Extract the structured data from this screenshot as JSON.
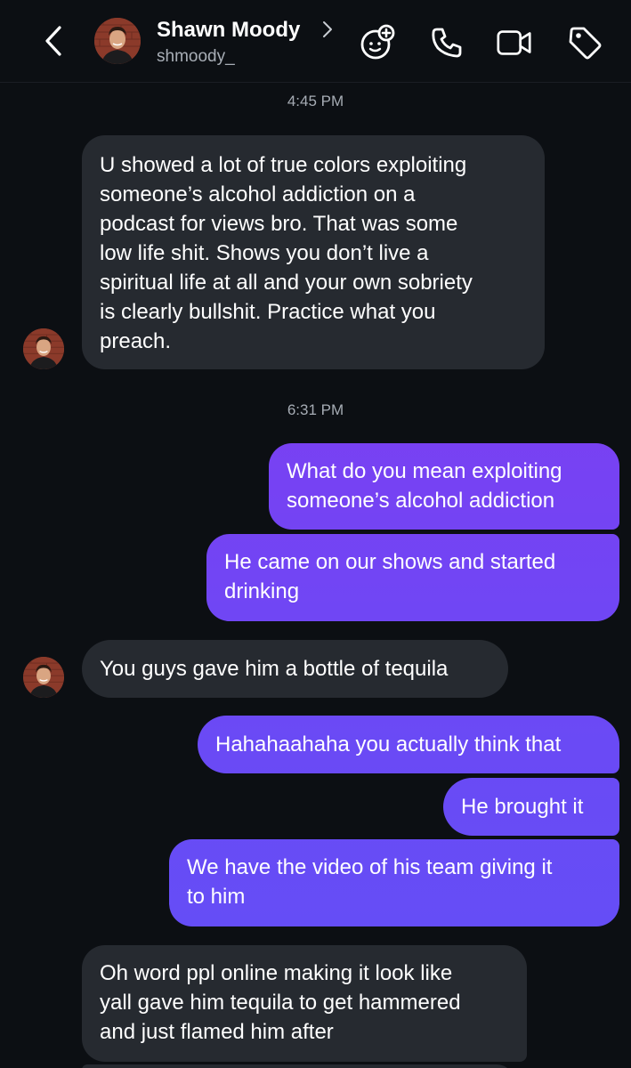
{
  "header": {
    "name": "Shawn Moody",
    "username": "shmoody_"
  },
  "icons": {
    "back": "chevron-left-icon",
    "effects": "sparkle-face-icon",
    "call": "phone-icon",
    "video": "video-camera-icon",
    "tag": "tag-icon"
  },
  "colors": {
    "background": "#0c0f13",
    "incoming_bubble": "#262a30",
    "outgoing_gradient_top": "#8a33ee",
    "outgoing_gradient_bottom": "#6150f6"
  },
  "conversation": {
    "timestamp_1": "4:45 PM",
    "timestamp_2": "6:31 PM",
    "messages": [
      {
        "sender": "them",
        "text": "U showed a lot of true colors exploiting\nsomeone’s alcohol addiction on a\npodcast for views bro. That was some\nlow life shit. Shows you don’t live a\nspiritual life at all and your own sobriety\nis clearly bullshit. Practice what you\npreach."
      },
      {
        "sender": "me",
        "text": "What do you mean exploiting\nsomeone’s alcohol addiction"
      },
      {
        "sender": "me",
        "text": "He came on our shows and started\ndrinking"
      },
      {
        "sender": "them",
        "text": "You guys gave him a bottle of tequila"
      },
      {
        "sender": "me",
        "text": "Hahahaahaha you actually think that"
      },
      {
        "sender": "me",
        "text": "He brought it"
      },
      {
        "sender": "me",
        "text": "We have the video of his team giving it\nto him"
      },
      {
        "sender": "them",
        "text": "Oh word ppl online making it look like\nyall gave him tequila to get hammered\nand just flamed him after"
      }
    ]
  }
}
